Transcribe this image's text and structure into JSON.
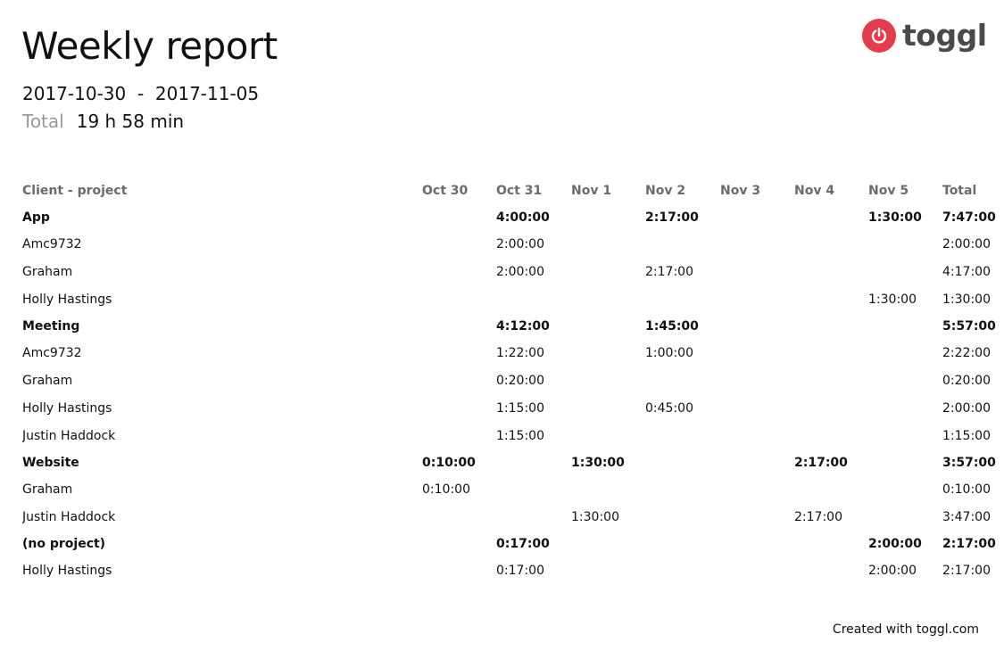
{
  "report": {
    "title": "Weekly report",
    "date_start": "2017-10-30",
    "date_separator": "-",
    "date_end": "2017-11-05",
    "total_label": "Total",
    "total_value": "19 h 58 min"
  },
  "brand": {
    "name": "toggl",
    "icon": "power-icon",
    "accent_color": "#e33d4d",
    "text_color": "#4a4a4a"
  },
  "table": {
    "headers": [
      "Client - project",
      "Oct 30",
      "Oct 31",
      "Nov 1",
      "Nov 2",
      "Nov 3",
      "Nov 4",
      "Nov 5",
      "Total"
    ],
    "rows": [
      {
        "kind": "group",
        "cells": [
          "App",
          "",
          "4:00:00",
          "",
          "2:17:00",
          "",
          "",
          "1:30:00",
          "7:47:00"
        ]
      },
      {
        "kind": "item",
        "cells": [
          "Amc9732",
          "",
          "2:00:00",
          "",
          "",
          "",
          "",
          "",
          "2:00:00"
        ]
      },
      {
        "kind": "item",
        "cells": [
          "Graham",
          "",
          "2:00:00",
          "",
          "2:17:00",
          "",
          "",
          "",
          "4:17:00"
        ]
      },
      {
        "kind": "item",
        "cells": [
          "Holly Hastings",
          "",
          "",
          "",
          "",
          "",
          "",
          "1:30:00",
          "1:30:00"
        ]
      },
      {
        "kind": "group",
        "cells": [
          "Meeting",
          "",
          "4:12:00",
          "",
          "1:45:00",
          "",
          "",
          "",
          "5:57:00"
        ]
      },
      {
        "kind": "item",
        "cells": [
          "Amc9732",
          "",
          "1:22:00",
          "",
          "1:00:00",
          "",
          "",
          "",
          "2:22:00"
        ]
      },
      {
        "kind": "item",
        "cells": [
          "Graham",
          "",
          "0:20:00",
          "",
          "",
          "",
          "",
          "",
          "0:20:00"
        ]
      },
      {
        "kind": "item",
        "cells": [
          "Holly Hastings",
          "",
          "1:15:00",
          "",
          "0:45:00",
          "",
          "",
          "",
          "2:00:00"
        ]
      },
      {
        "kind": "item",
        "cells": [
          "Justin Haddock",
          "",
          "1:15:00",
          "",
          "",
          "",
          "",
          "",
          "1:15:00"
        ]
      },
      {
        "kind": "group",
        "cells": [
          "Website",
          "0:10:00",
          "",
          "1:30:00",
          "",
          "",
          "2:17:00",
          "",
          "3:57:00"
        ]
      },
      {
        "kind": "item",
        "cells": [
          "Graham",
          "0:10:00",
          "",
          "",
          "",
          "",
          "",
          "",
          "0:10:00"
        ]
      },
      {
        "kind": "item",
        "cells": [
          "Justin Haddock",
          "",
          "",
          "1:30:00",
          "",
          "",
          "2:17:00",
          "",
          "3:47:00"
        ]
      },
      {
        "kind": "group",
        "cells": [
          "(no project)",
          "",
          "0:17:00",
          "",
          "",
          "",
          "",
          "2:00:00",
          "2:17:00"
        ]
      },
      {
        "kind": "item",
        "cells": [
          "Holly Hastings",
          "",
          "0:17:00",
          "",
          "",
          "",
          "",
          "2:00:00",
          "2:17:00"
        ]
      }
    ]
  },
  "footer": {
    "text": "Created with toggl.com"
  }
}
